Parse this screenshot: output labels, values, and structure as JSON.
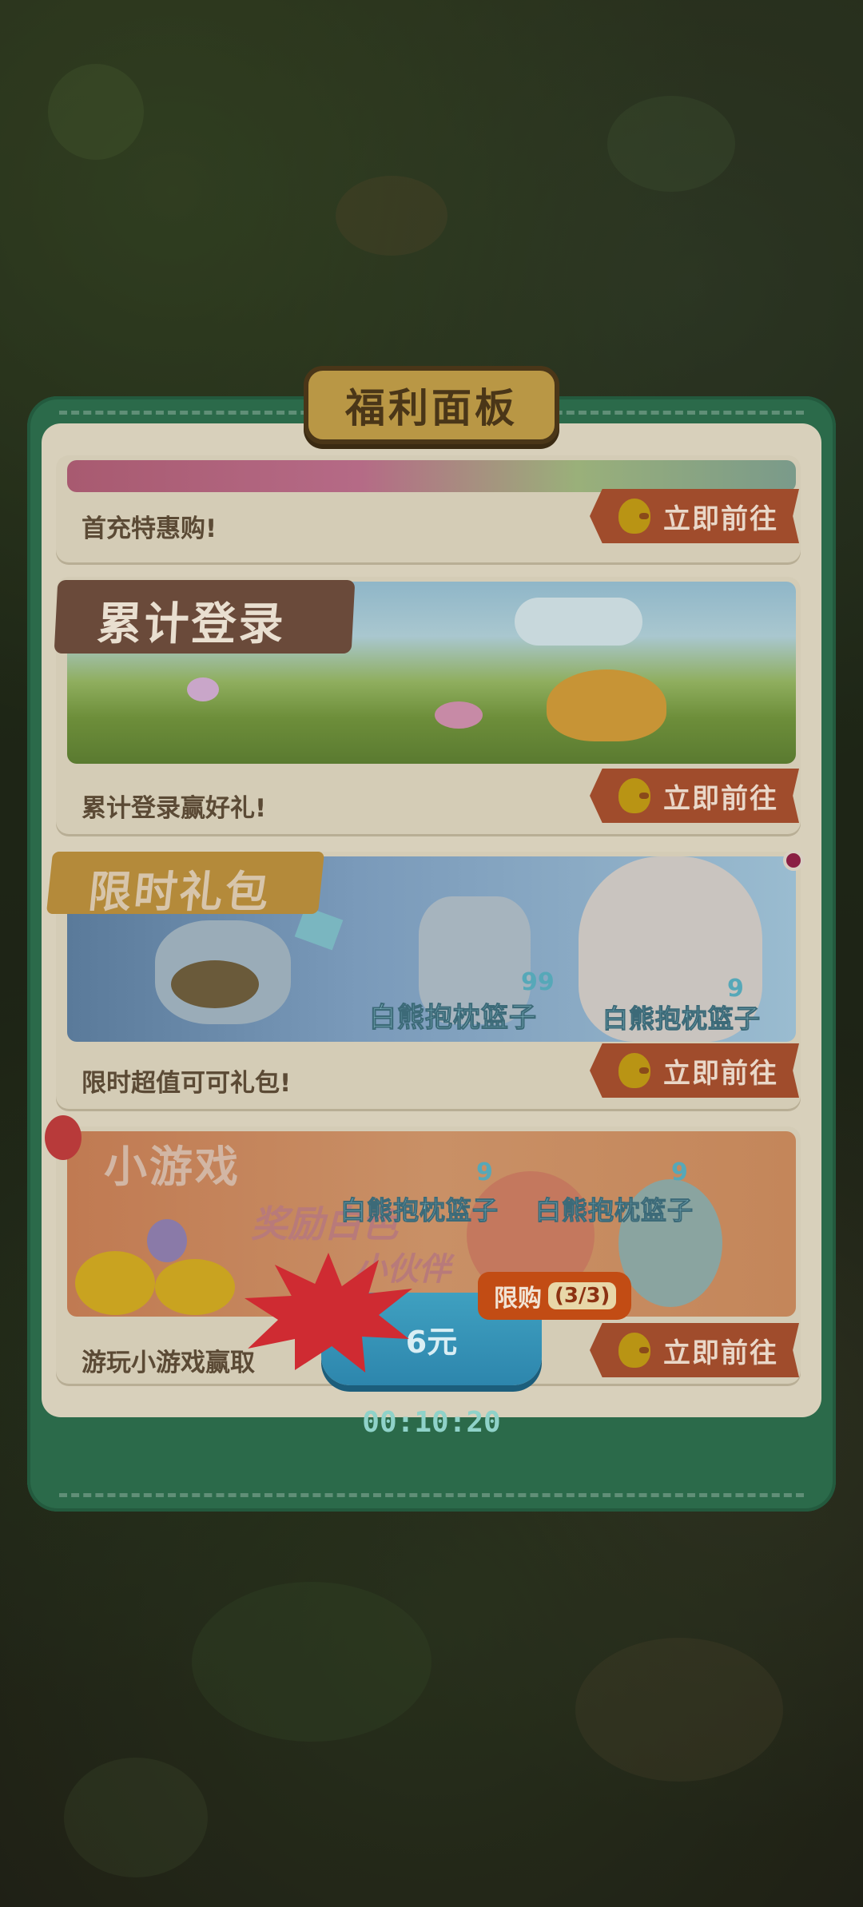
{
  "panel": {
    "title": "福利面板"
  },
  "cards": [
    {
      "banner_title": "",
      "description": "首充特惠购!",
      "button_label": "立即前往"
    },
    {
      "banner_title": "累计登录",
      "description": "累计登录赢好礼!",
      "button_label": "立即前往"
    },
    {
      "banner_title": "限时礼包",
      "description": "限时超值可可礼包!",
      "button_label": "立即前往",
      "items": [
        {
          "count": "99",
          "name": "白熊抱枕篮子"
        },
        {
          "count": "9",
          "name": "白熊抱枕篮子"
        }
      ]
    },
    {
      "banner_title": "小游戏",
      "banner_subtitle": "奖励白色",
      "banner_subtitle2": "小伙伴",
      "description": "游玩小游戏赢取",
      "button_label": "立即前往",
      "items": [
        {
          "count": "9",
          "name": "白熊抱枕篮子"
        },
        {
          "count": "9",
          "name": "白熊抱枕篮子"
        }
      ]
    }
  ],
  "purchase": {
    "price_label": "6元",
    "limit_label": "限购",
    "limit_count": "(3/3)",
    "timer": "00:10:20"
  },
  "colors": {
    "panel_green": "#2b6a4a",
    "button_red": "#a04c2c",
    "title_gold": "#b99745",
    "buy_blue": "#2d86ad"
  }
}
